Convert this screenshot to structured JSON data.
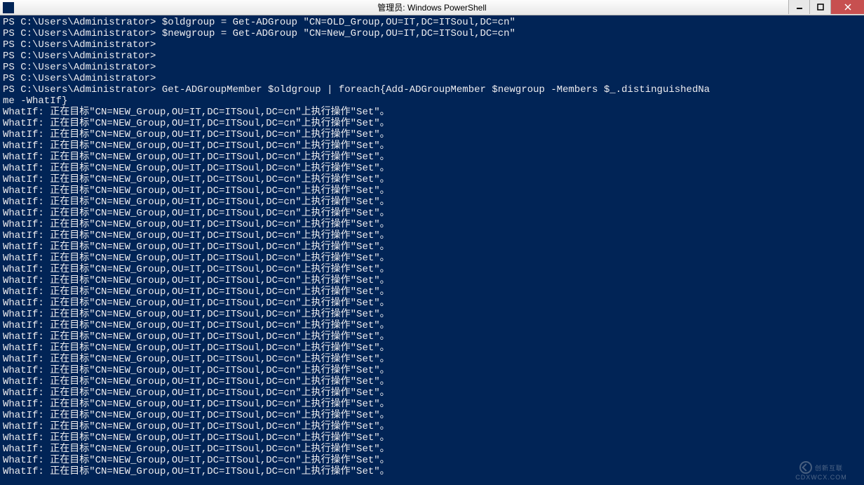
{
  "window": {
    "title": "管理员: Windows PowerShell"
  },
  "terminal": {
    "prompt": "PS C:\\Users\\Administrator>",
    "lines": [
      "PS C:\\Users\\Administrator> $oldgroup = Get-ADGroup \"CN=OLD_Group,OU=IT,DC=ITSoul,DC=cn\"",
      "PS C:\\Users\\Administrator> $newgroup = Get-ADGroup \"CN=New_Group,OU=IT,DC=ITSoul,DC=cn\"",
      "PS C:\\Users\\Administrator>",
      "PS C:\\Users\\Administrator>",
      "PS C:\\Users\\Administrator>",
      "PS C:\\Users\\Administrator>",
      "PS C:\\Users\\Administrator> Get-ADGroupMember $oldgroup | foreach{Add-ADGroupMember $newgroup -Members $_.distinguishedNa",
      "me -WhatIf}"
    ],
    "whatif_line": "WhatIf: 正在目标\"CN=NEW_Group,OU=IT,DC=ITSoul,DC=cn\"上执行操作\"Set\"。",
    "whatif_count": 33
  },
  "watermark": {
    "brand": "创新互联",
    "sub": "CDXWCX.COM"
  }
}
